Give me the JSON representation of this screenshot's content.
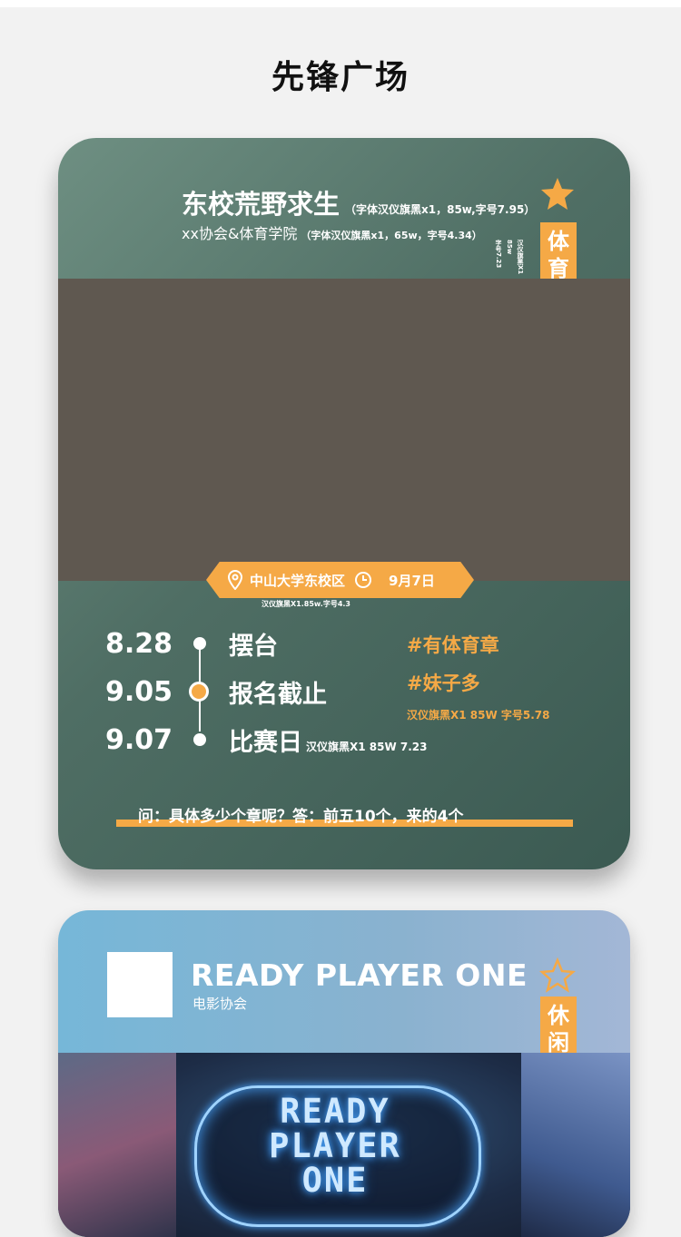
{
  "header": {
    "title": "先锋广场"
  },
  "card1": {
    "title": "东校荒野求生",
    "title_note": "（字体汉仪旗黑x1，85w,字号7.95）",
    "subtitle": "xx协会&体育学院",
    "subtitle_note": "（字体汉仪旗黑x1，65w，字号4.34）",
    "vertical_notes": [
      "汉仪旗黑X1",
      "85w",
      "字号7.23"
    ],
    "tag": [
      "体",
      "育"
    ],
    "location": "中山大学东校区",
    "date": "9月7日",
    "location_note": "汉仪旗黑X1.85w.字号4.3",
    "timeline": [
      {
        "date": "8.28",
        "event": "摆台",
        "note": ""
      },
      {
        "date": "9.05",
        "event": "报名截止",
        "note": ""
      },
      {
        "date": "9.07",
        "event": "比赛日",
        "note": "汉仪旗黑X1 85W 7.23"
      }
    ],
    "hashtag1": "#有体育章",
    "hashtag2": "#妹子多",
    "hashtag_note": "汉仪旗黑X1 85W 字号5.78",
    "qa": "问：具体多少个章呢？答：前五10个，来的4个",
    "colors": {
      "accent": "#f5a946",
      "card_bg": "#4f6e64",
      "photo_placeholder": "#5f5850"
    }
  },
  "card2": {
    "title": "READY PLAYER ONE",
    "subtitle": "电影协会",
    "tag": [
      "休",
      "闲"
    ],
    "poster_logo": [
      "READY",
      "PLAYER",
      "ONE"
    ],
    "colors": {
      "card_bg": "#85b6d4"
    }
  }
}
